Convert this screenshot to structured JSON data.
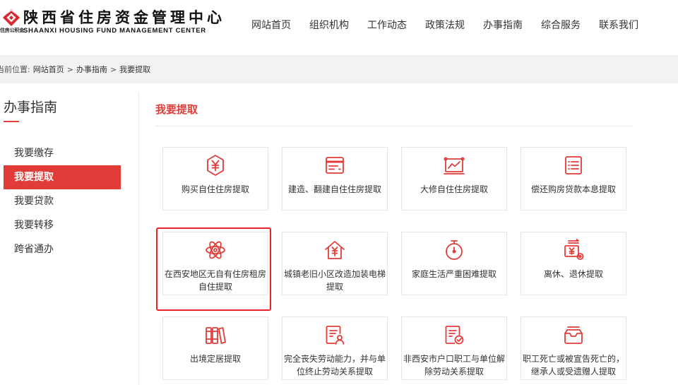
{
  "colors": {
    "accent": "#e23c39",
    "text": "#333333",
    "breadcrumb_bg": "#f2f2f2",
    "border": "#e6e6e6",
    "annotation": "#e8232a"
  },
  "header": {
    "logo": {
      "emblem_icon": "housing-fund-emblem-icon",
      "emblem_text": "住房公积金",
      "title": "陕西省住房资金管理中心",
      "subtitle": "SHAANXI HOUSING FUND MANAGEMENT CENTER"
    },
    "nav": [
      {
        "label": "网站首页"
      },
      {
        "label": "组织机构"
      },
      {
        "label": "工作动态"
      },
      {
        "label": "政策法规"
      },
      {
        "label": "办事指南"
      },
      {
        "label": "综合服务"
      },
      {
        "label": "联系我们"
      }
    ]
  },
  "breadcrumb": {
    "prefix": "当前位置:",
    "separator": ">",
    "items": [
      {
        "label": "网站首页"
      },
      {
        "label": "办事指南"
      },
      {
        "label": "我要提取"
      }
    ]
  },
  "sidebar": {
    "title": "办事指南",
    "items": [
      {
        "label": "我要缴存",
        "active": false
      },
      {
        "label": "我要提取",
        "active": true
      },
      {
        "label": "我要贷款",
        "active": false
      },
      {
        "label": "我要转移",
        "active": false
      },
      {
        "label": "跨省通办",
        "active": false
      }
    ]
  },
  "main": {
    "title": "我要提取",
    "cards": [
      {
        "label": "购买自住住房提取",
        "icon": "yen-shield-icon"
      },
      {
        "label": "建造、翻建自住住房提取",
        "icon": "card-icon"
      },
      {
        "label": "大修自住住房提取",
        "icon": "chart-board-icon"
      },
      {
        "label": "偿还购房贷款本息提取",
        "icon": "list-document-icon"
      },
      {
        "label": "在西安地区无自有住房租房自住提取",
        "icon": "atom-icon"
      },
      {
        "label": "城镇老旧小区改造加装电梯提取",
        "icon": "house-yen-icon"
      },
      {
        "label": "家庭生活严重困难提取",
        "icon": "stopwatch-icon"
      },
      {
        "label": "离休、退休提取",
        "icon": "money-gear-icon"
      },
      {
        "label": "出境定居提取",
        "icon": "books-icon"
      },
      {
        "label": "完全丧失劳动能力，并与单位终止劳动关系提取",
        "icon": "document-user-icon"
      },
      {
        "label": "非西安市户口职工与单位解除劳动关系提取",
        "icon": "document-check-icon"
      },
      {
        "label": "职工死亡或被宣告死亡的，继承人或受遗赠人提取",
        "icon": "inbox-icon"
      }
    ]
  }
}
